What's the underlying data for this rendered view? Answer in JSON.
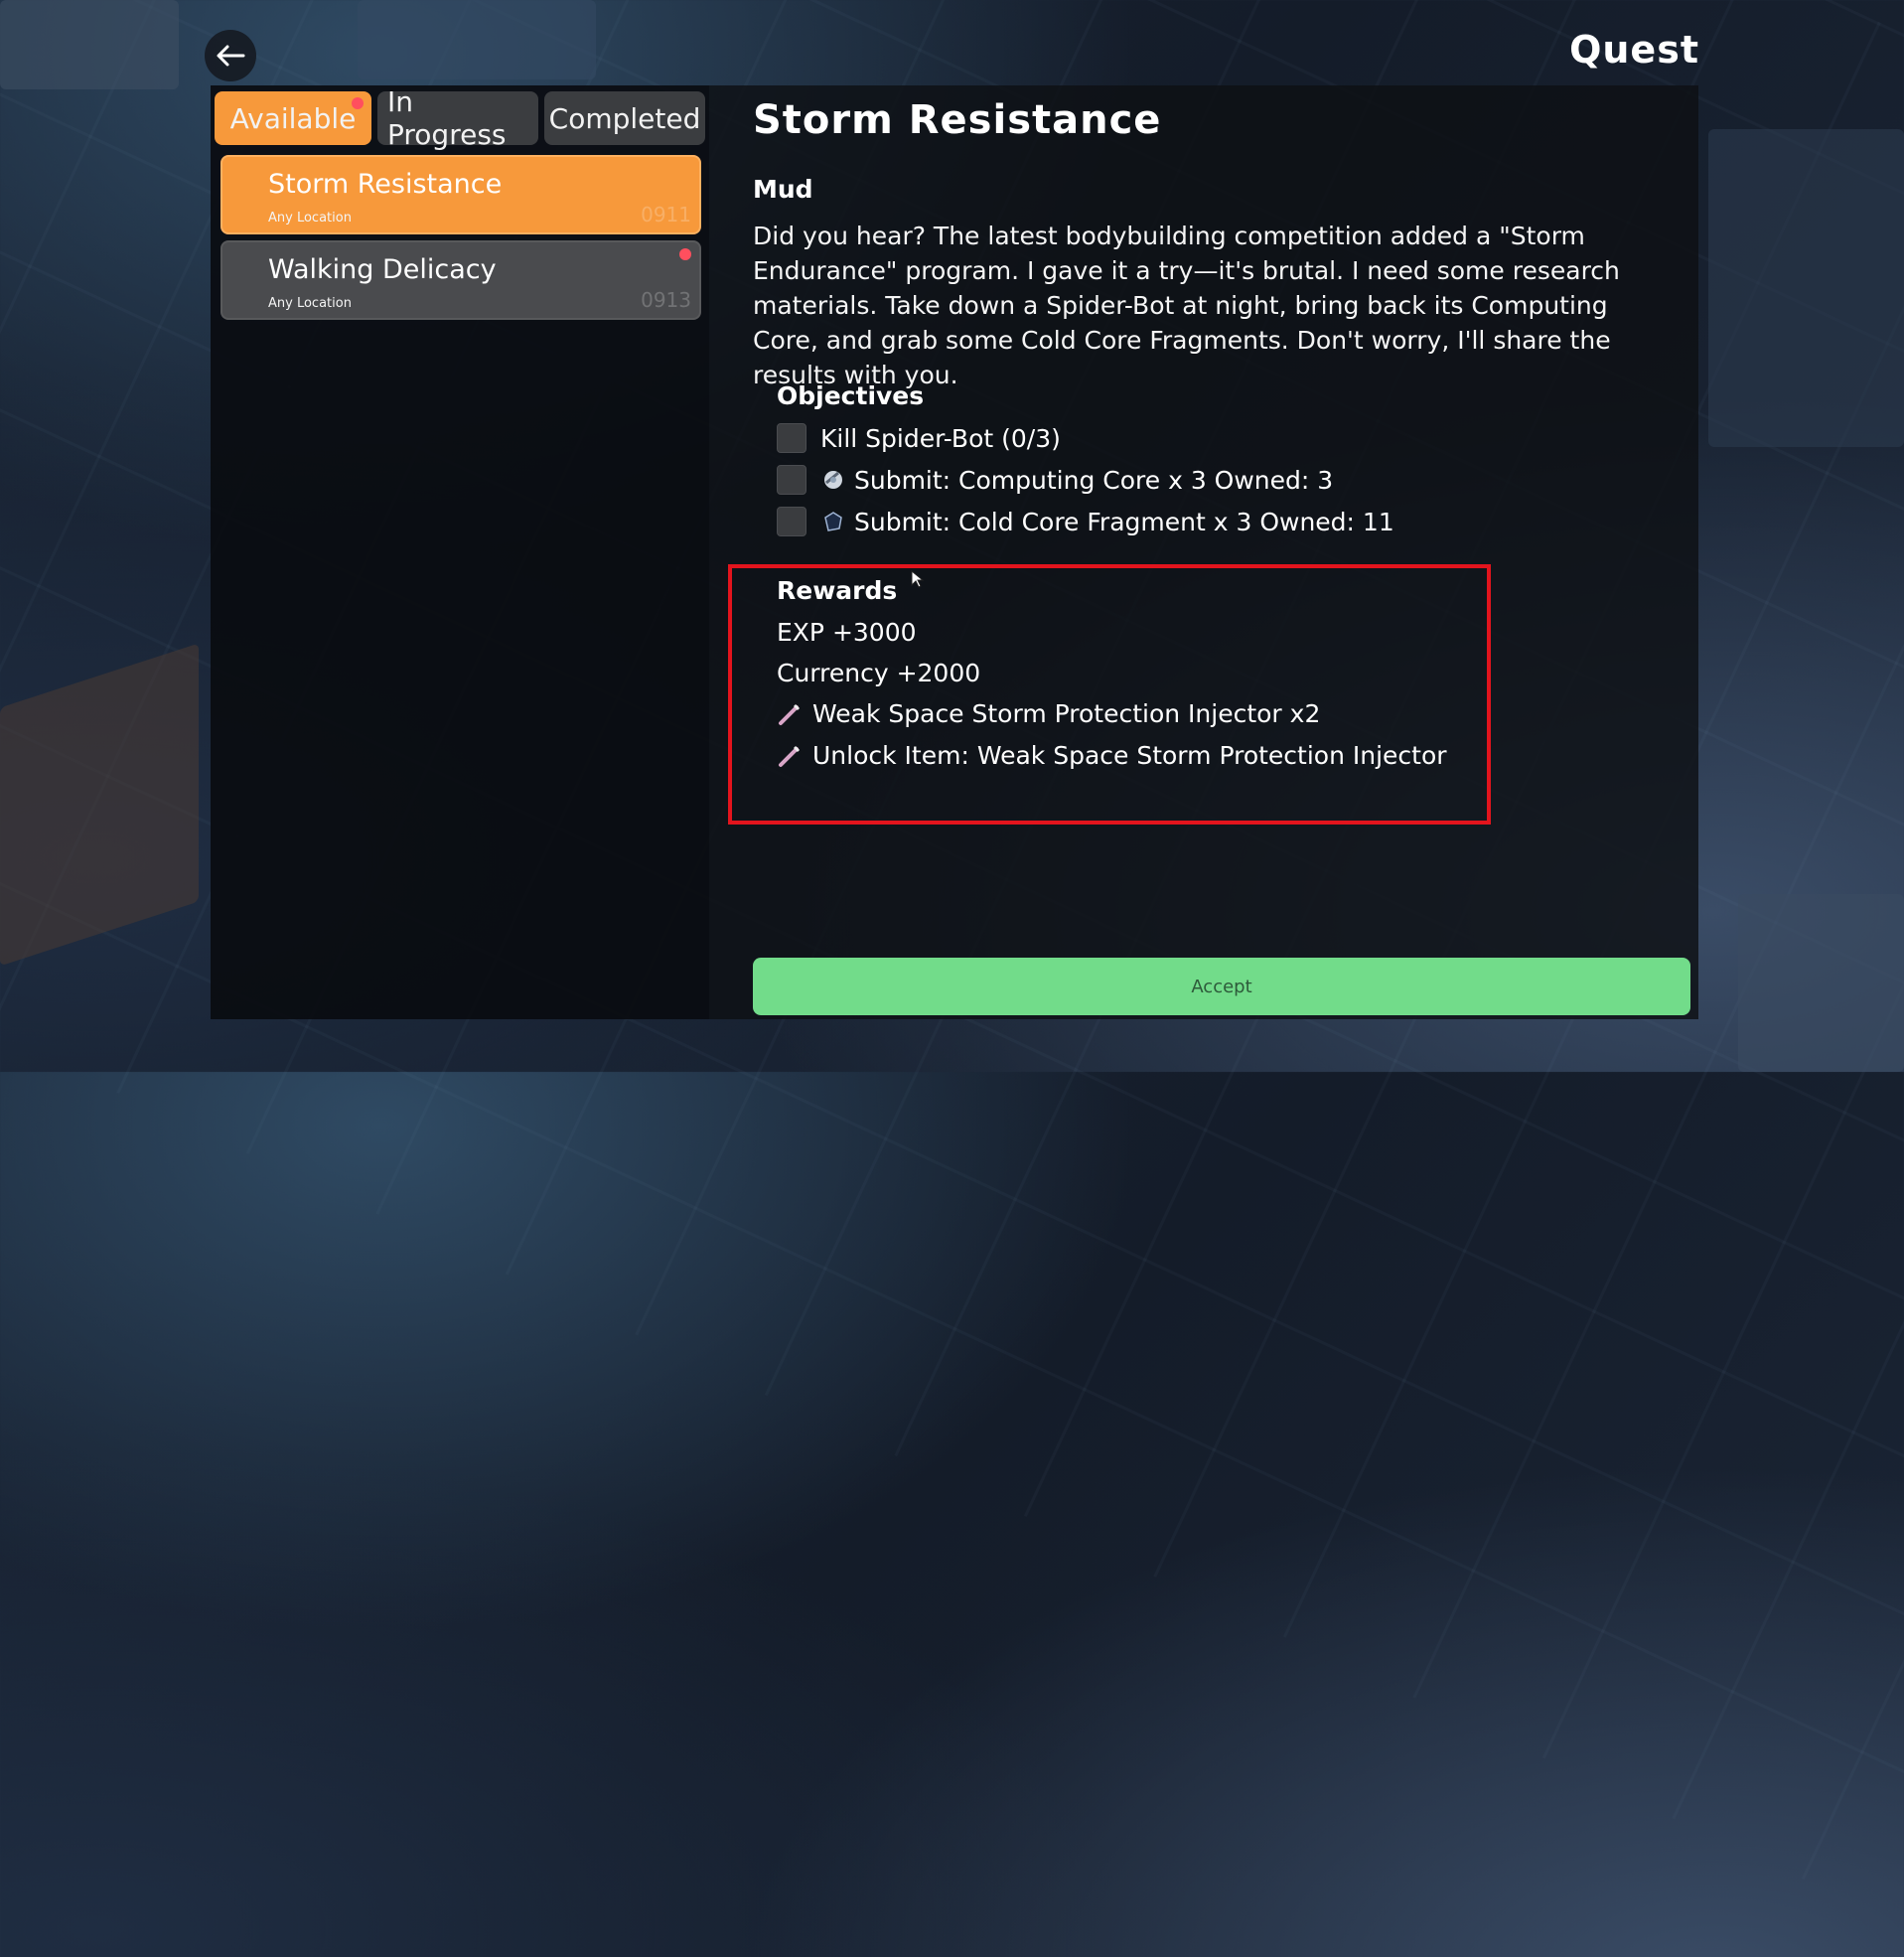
{
  "screen": {
    "title": "Quest"
  },
  "tabs": [
    {
      "label": "Available",
      "active": true,
      "has_notification": true
    },
    {
      "label": "In Progress",
      "active": false
    },
    {
      "label": "Completed",
      "active": false
    }
  ],
  "quests": [
    {
      "name": "Storm Resistance",
      "location": "Any Location",
      "code": "0911",
      "selected": true
    },
    {
      "name": "Walking Delicacy",
      "location": "Any Location",
      "code": "0913",
      "selected": false,
      "has_notification": true
    }
  ],
  "detail": {
    "title": "Storm Resistance",
    "giver": "Mud",
    "description": "Did you hear? The latest bodybuilding competition added a \"Storm Endurance\" program. I gave it a try—it's brutal. I need some research materials. Take down a Spider-Bot at night, bring back its Computing Core, and grab some Cold Core Fragments. Don't worry, I'll share the results with you.",
    "objectives_heading": "Objectives",
    "objectives": [
      {
        "text": "Kill Spider-Bot (0/3)",
        "icon": null
      },
      {
        "text": "Submit: Computing Core x 3 Owned: 3",
        "icon": "computing-core-icon"
      },
      {
        "text": "Submit: Cold Core Fragment x 3 Owned: 11",
        "icon": "cold-core-fragment-icon"
      }
    ],
    "rewards_heading": "Rewards",
    "rewards": [
      {
        "text": "EXP +3000",
        "icon": null
      },
      {
        "text": "Currency +2000",
        "icon": null
      },
      {
        "text": "Weak Space Storm Protection Injector x2",
        "icon": "injector-icon"
      },
      {
        "text": "Unlock Item: Weak Space Storm Protection Injector",
        "icon": "injector-icon"
      }
    ]
  },
  "accept_label": "Accept",
  "colors": {
    "tab_active": "#f7993b",
    "accept": "#72dc8a",
    "highlight_box": "#e3141d",
    "notification_dot": "#ff4f5e"
  }
}
